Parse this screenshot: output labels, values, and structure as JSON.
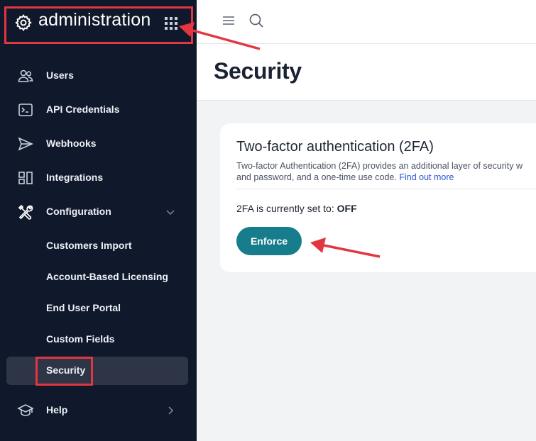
{
  "sidebar": {
    "brand_title": "administration",
    "items": [
      {
        "label": "Users"
      },
      {
        "label": "API Credentials"
      },
      {
        "label": "Webhooks"
      },
      {
        "label": "Integrations"
      },
      {
        "label": "Configuration"
      }
    ],
    "sub_items": [
      {
        "label": "Customers Import"
      },
      {
        "label": "Account-Based Licensing"
      },
      {
        "label": "End User Portal"
      },
      {
        "label": "Custom Fields"
      },
      {
        "label": "Security"
      }
    ],
    "help_label": "Help"
  },
  "header": {
    "page_title": "Security"
  },
  "card": {
    "title": "Two-factor authentication (2FA)",
    "desc_line1": "Two-factor Authentication (2FA) provides an additional layer of security w",
    "desc_line2": "and password, and a one-time use code.",
    "link_text": "Find out more",
    "status_prefix": "2FA is currently set to:",
    "status_value": "OFF",
    "button_label": "Enforce"
  },
  "colors": {
    "sidebar_bg": "#10182b",
    "active_bg": "#2e3547",
    "accent": "#177c8c",
    "link": "#2d56d6",
    "annotation": "#e23641"
  }
}
